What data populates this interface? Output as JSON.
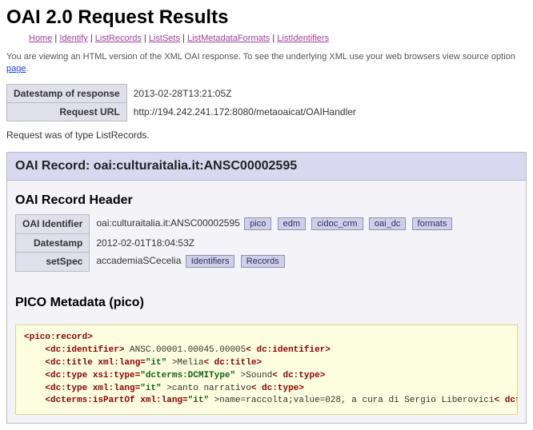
{
  "title": "OAI 2.0 Request Results",
  "nav": {
    "home": "Home",
    "identify": "Identify",
    "listRecords": "ListRecords",
    "listSets": "ListSets",
    "listMetadataFormats": "ListMetadataFormats",
    "listIdentifiers": "ListIdentifiers"
  },
  "intro": {
    "text1": "You are viewing an HTML version of the XML OAI response. To see the underlying XML use your web browsers view source option ",
    "pageLink": "page",
    "text2": "."
  },
  "response": {
    "datestampLabel": "Datestamp of response",
    "datestamp": "2013-02-28T13:21:05Z",
    "urlLabel": "Request URL",
    "url": "http://194.242.241.172:8080/metaoaicat/OAIHandler"
  },
  "noteText": "Request was of type ListRecords.",
  "record": {
    "titlePrefix": "OAI Record: ",
    "titleId": "oai:culturaitalia.it:ANSC00002595",
    "headerHeading": "OAI Record Header",
    "oaiIdLabel": "OAI Identifier",
    "oaiId": "oai:culturaitalia.it:ANSC00002595",
    "formats": {
      "pico": "pico",
      "edm": "edm",
      "cidoc": "cidoc_crm",
      "oai_dc": "oai_dc",
      "formats": "formats"
    },
    "datestampLabel": "Datestamp",
    "datestamp": "2012-02-01T18:04:53Z",
    "setSpecLabel": "setSpec",
    "setSpec": "accademiaSCecelia",
    "identifiersBtn": "Identifiers",
    "recordsBtn": "Records"
  },
  "pico": {
    "heading": "PICO Metadata (pico)",
    "xml": {
      "l1a": "<pico:record>",
      "l2a": "<dc:identifier>",
      "l2b": " ANSC.00001.00045.00005",
      "l2c": "< dc:identifier>",
      "l3a": "<dc:title xml:lang=",
      "l3v": "\"it\"",
      "l3b": " >Melia",
      "l3c": "< dc:title>",
      "l4a": "<dc:type xsi:type=",
      "l4v": "\"dcterms:DCMIType\"",
      "l4b": " >Sound",
      "l4c": "< dc:type>",
      "l5a": "<dc:type xml:lang=",
      "l5v": "\"it\"",
      "l5b": " >canto narrativo",
      "l5c": "< dc:type>",
      "l6a": "<dcterms:isPartOf xml:lang=",
      "l6v": "\"it\"",
      "l6b": " >name=raccolta;value=028, a cura di Sergio Liberovici",
      "l6c": "< dcterms:isPartOf>"
    }
  }
}
